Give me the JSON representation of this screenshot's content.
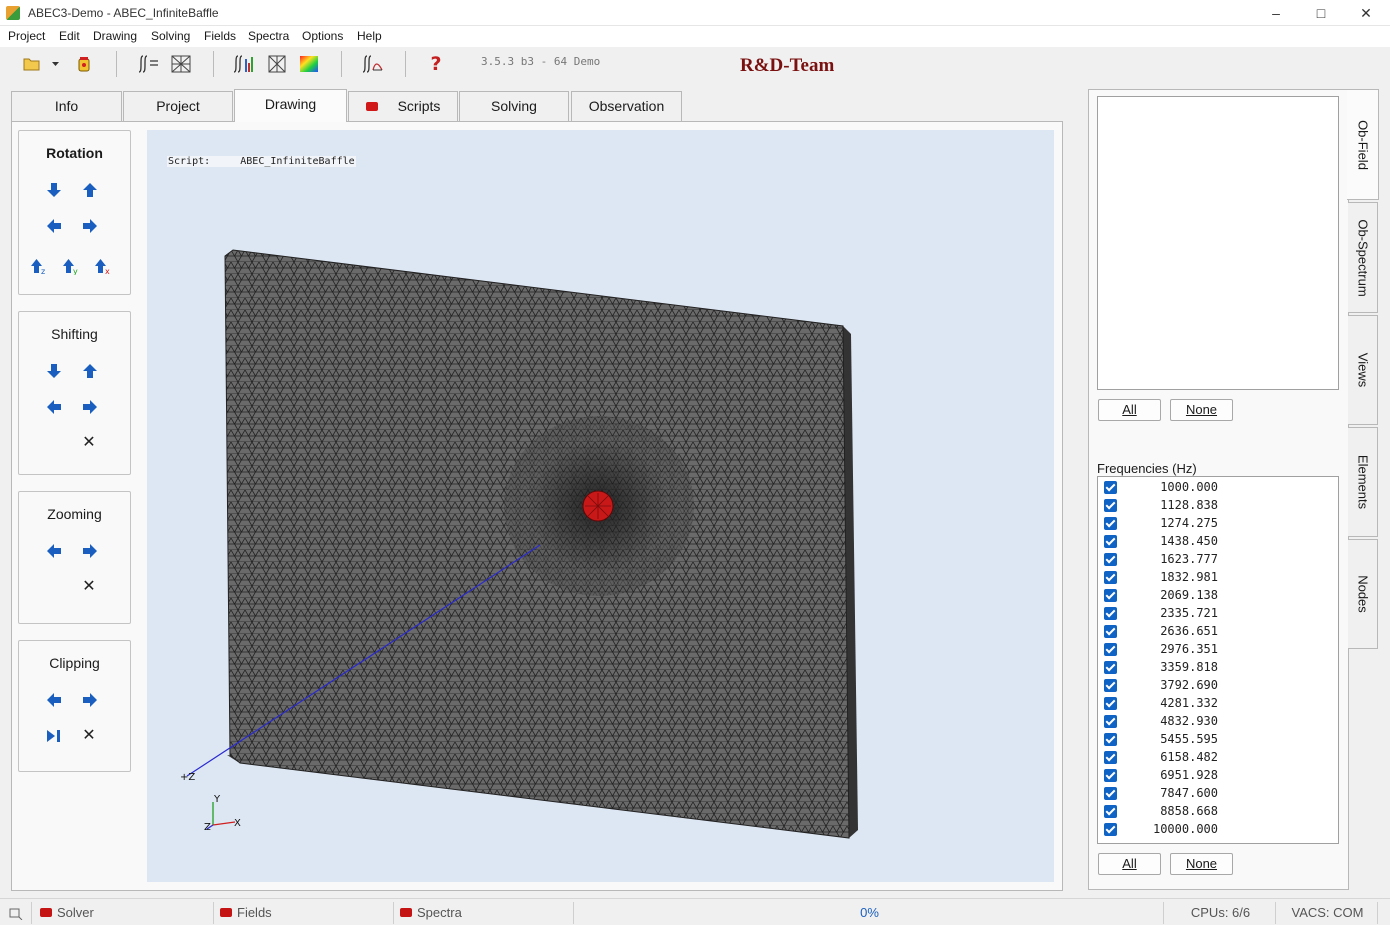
{
  "window": {
    "title": "ABEC3-Demo - ABEC_InfiniteBaffle"
  },
  "menu": [
    "Project",
    "Edit",
    "Drawing",
    "Solving",
    "Fields",
    "Spectra",
    "Options",
    "Help"
  ],
  "toolbar": {
    "version": "3.5.3 b3 - 64 Demo",
    "team": "R&D-Team"
  },
  "tabs": [
    {
      "label": "Info"
    },
    {
      "label": "Project"
    },
    {
      "label": "Drawing",
      "active": true
    },
    {
      "label": "Scripts",
      "indicator": "red"
    },
    {
      "label": "Solving"
    },
    {
      "label": "Observation"
    }
  ],
  "controls": {
    "rotation": {
      "title": "Rotation"
    },
    "shifting": {
      "title": "Shifting"
    },
    "zooming": {
      "title": "Zooming"
    },
    "clipping": {
      "title": "Clipping"
    }
  },
  "viewport": {
    "script_label": "Script:",
    "script_name": "ABEC_InfiniteBaffle",
    "axis_z_label": "+Z",
    "triad_y": "Y",
    "triad_z": "Z",
    "triad_x": "X",
    "mesh_color": "#3a3a3a",
    "source_color": "#c81818",
    "background": "#dde7f3"
  },
  "observation": {
    "all_label": "All",
    "none_label": "None"
  },
  "frequencies": {
    "title": "Frequencies  (Hz)",
    "values": [
      "1000.000",
      "1128.838",
      "1274.275",
      "1438.450",
      "1623.777",
      "1832.981",
      "2069.138",
      "2335.721",
      "2636.651",
      "2976.351",
      "3359.818",
      "3792.690",
      "4281.332",
      "4832.930",
      "5455.595",
      "6158.482",
      "6951.928",
      "7847.600",
      "8858.668",
      "10000.000"
    ],
    "all_label": "All",
    "none_label": "None"
  },
  "side_tabs": [
    "Ob-Field",
    "Ob-Spectrum",
    "Views",
    "Elements",
    "Nodes"
  ],
  "status": {
    "solver": "Solver",
    "fields": "Fields",
    "spectra": "Spectra",
    "progress": "0%",
    "cpus": "CPUs: 6/6",
    "vacs": "VACS: COM"
  }
}
